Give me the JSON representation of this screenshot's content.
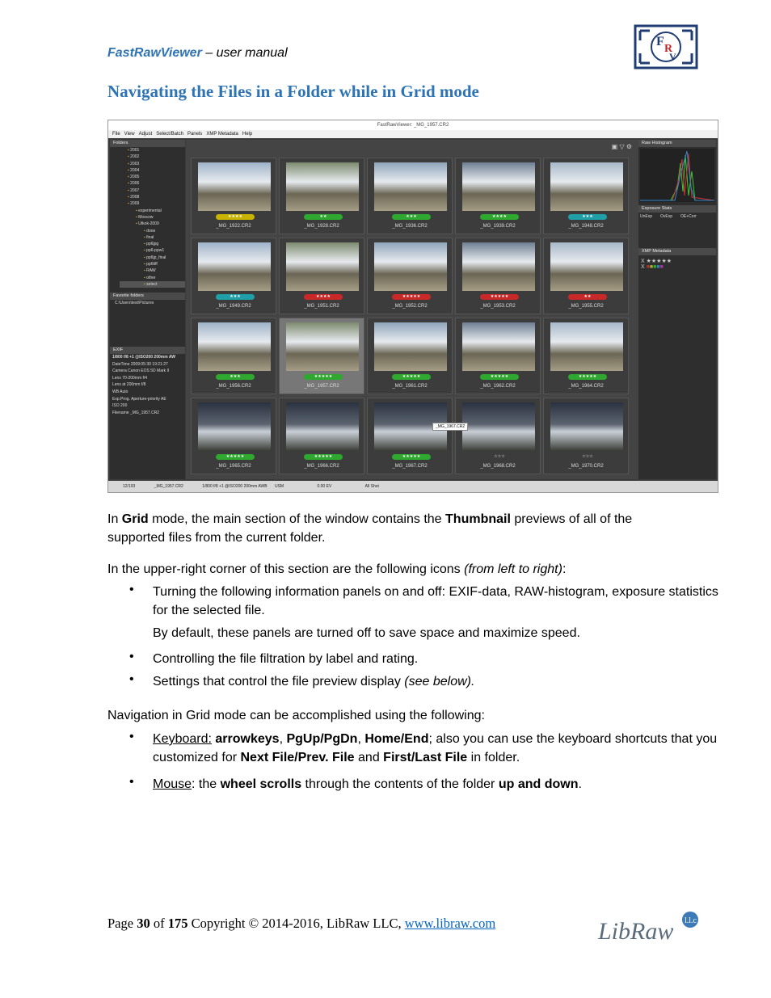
{
  "header": {
    "app_name": "FastRawViewer",
    "suffix": " – user manual"
  },
  "title": "Navigating the Files in a Folder while in Grid mode",
  "screenshot": {
    "window_title": "FastRawViewer: _MG_1957.CR2",
    "menu": [
      "File",
      "View",
      "Adjust",
      "Select/Batch",
      "Panels",
      "XMP Metadata",
      "Help"
    ],
    "panels": {
      "folders": "Folders",
      "favorites": "Favorite folders",
      "exif": "EXIF",
      "histogram": "Raw Histogram",
      "exposure": "Exposure Stats",
      "xmp": "XMP Metadata"
    },
    "folders": [
      "2001",
      "2002",
      "2003",
      "2004",
      "2005",
      "2006",
      "2007",
      "2008",
      "2009",
      "experimental",
      "Moscow",
      "Utkok-2009",
      "done",
      "final",
      "pp6jpg",
      "pp6-ppw1",
      "pp6jp_final",
      "pp6tiff",
      "RAW",
      "other",
      "select"
    ],
    "favorite": "C:\\Users\\test\\Pictures",
    "exif_lines": [
      "1/800 f/8 +1 @ISO200 200mm AW",
      "DateTime  2009:05:30 19:21:27",
      "Camera  Canon EOS 5D Mark II",
      "Lens  70-200mm f/4",
      "Lens at  200mm f/8",
      "WB  Auto",
      "Exp.Prog.  Aperture-priority AE",
      "ISO  200",
      "Filename  _MG_1957.CR2"
    ],
    "thumbnails": [
      {
        "name": "_MG_1922.CR2",
        "stars": "★★★★",
        "label": "#c8b400"
      },
      {
        "name": "_MG_1928.CR2",
        "stars": "★★",
        "label": "#2ea82e"
      },
      {
        "name": "_MG_1936.CR2",
        "stars": "★★★",
        "label": "#2ea82e"
      },
      {
        "name": "_MG_1939.CR2",
        "stars": "★★★★",
        "label": "#2ea82e"
      },
      {
        "name": "_MG_1948.CR2",
        "stars": "★★★",
        "label": "#1fa0a8"
      },
      {
        "name": "_MG_1949.CR2",
        "stars": "★★★",
        "label": "#1fa0a8"
      },
      {
        "name": "_MG_1951.CR2",
        "stars": "★★★★",
        "label": "#c82828"
      },
      {
        "name": "_MG_1952.CR2",
        "stars": "★★★★★",
        "label": "#c82828"
      },
      {
        "name": "_MG_1953.CR2",
        "stars": "★★★★★",
        "label": "#c82828"
      },
      {
        "name": "_MG_1955.CR2",
        "stars": "★★",
        "label": "#c82828"
      },
      {
        "name": "_MG_1956.CR2",
        "stars": "★★★",
        "label": "#2ea82e"
      },
      {
        "name": "_MG_1957.CR2",
        "stars": "★★★★★",
        "label": "#2ea82e"
      },
      {
        "name": "_MG_1961.CR2",
        "stars": "★★★★★",
        "label": "#2ea82e"
      },
      {
        "name": "_MG_1962.CR2",
        "stars": "★★★★★",
        "label": "#2ea82e"
      },
      {
        "name": "_MG_1964.CR2",
        "stars": "★★★★★",
        "label": "#2ea82e"
      },
      {
        "name": "_MG_1965.CR2",
        "stars": "★★★★★",
        "label": "#2ea82e"
      },
      {
        "name": "_MG_1966.CR2",
        "stars": "★★★★★",
        "label": "#2ea82e"
      },
      {
        "name": "_MG_1967.CR2",
        "stars": "★★★★★",
        "label": "#2ea82e"
      },
      {
        "name": "_MG_1968.CR2",
        "stars": "☆☆☆",
        "label": ""
      },
      {
        "name": "_MG_1970.CR2",
        "stars": "☆☆☆",
        "label": ""
      }
    ],
    "tooltip": "_MG_1967.CR2",
    "status": {
      "counter": "12/193",
      "file": "_MG_1957.CR2",
      "exposure": "1/800 f/8 +1 @ISO200 200mm AWB",
      "usm": "USM",
      "ev": "0.00 EV",
      "wb": "All Shot"
    },
    "exposure_cols": [
      "UnExp",
      "OvExp",
      "OE+Corr"
    ]
  },
  "body": {
    "p1": [
      "In ",
      "Grid",
      " mode, the main section of the window contains the ",
      "Thumbnail",
      " previews of all of the supported files from the current folder."
    ],
    "p2": [
      "In the upper-right corner of this section are the following icons ",
      "(from left to right)",
      ":"
    ],
    "b1": "Turning the following information panels on and off: EXIF-data, RAW-histogram, exposure statistics for the selected file.",
    "b1b": "By default, these panels are turned off to save space and maximize speed.",
    "b2": "Controlling the file filtration by label and rating.",
    "b3": [
      "Settings that control the file preview display ",
      "(see below)."
    ],
    "p3": "Navigation in Grid mode can be accomplished using the following:",
    "b4": [
      "Keyboard:",
      " ",
      "arrowkeys",
      ", ",
      "PgUp/PgDn",
      ", ",
      "Home/End",
      "; also you can use the keyboard shortcuts that you customized for ",
      "Next File/Prev. File",
      " and ",
      "First/Last File",
      " in folder."
    ],
    "b5": [
      "Mouse",
      ": the ",
      "wheel scrolls",
      " through the contents of the folder ",
      "up and down",
      "."
    ]
  },
  "footer": {
    "page_word": "Page ",
    "page": "30",
    "of": " of ",
    "total": "175",
    "copyright": " Copyright © 2014-2016, LibRaw LLC, ",
    "url": "www.libraw.com",
    "brand": "LibRaw"
  },
  "colors": {
    "accent": "#2e74b5",
    "link": "#0563c1"
  }
}
